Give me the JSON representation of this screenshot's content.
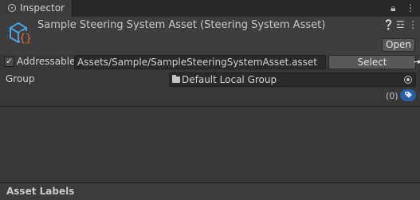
{
  "tab": {
    "title": "Inspector",
    "icon": "info-icon",
    "lock_icon": "lock-icon",
    "menu_icon": "kebab-menu-icon"
  },
  "header": {
    "asset_icon": "steering-asset-script-icon",
    "title": "Sample Steering System Asset (Steering System Asset)",
    "help_icon": "help-icon",
    "settings_icon": "settings-sliders-icon",
    "menu_icon": "kebab-menu-icon",
    "open_label": "Open"
  },
  "addressable": {
    "checked": true,
    "label": "Addressable",
    "address": "Assets/Sample/SampleSteeringSystemAsset.asset",
    "select_label": "Select"
  },
  "group": {
    "label": "Group",
    "value": "Default Local Group",
    "folder_icon": "folder-icon",
    "picker_icon": "object-picker-icon"
  },
  "labels": {
    "count": "(0)",
    "tag_icon": "tag-icon"
  },
  "footer": {
    "title": "Asset Labels"
  },
  "colors": {
    "background": "#383838",
    "header": "#3e3e3e",
    "tag_accent": "#2a5fa8",
    "asset_icon_blue": "#4aa3df",
    "asset_icon_orange": "#e8663c"
  }
}
